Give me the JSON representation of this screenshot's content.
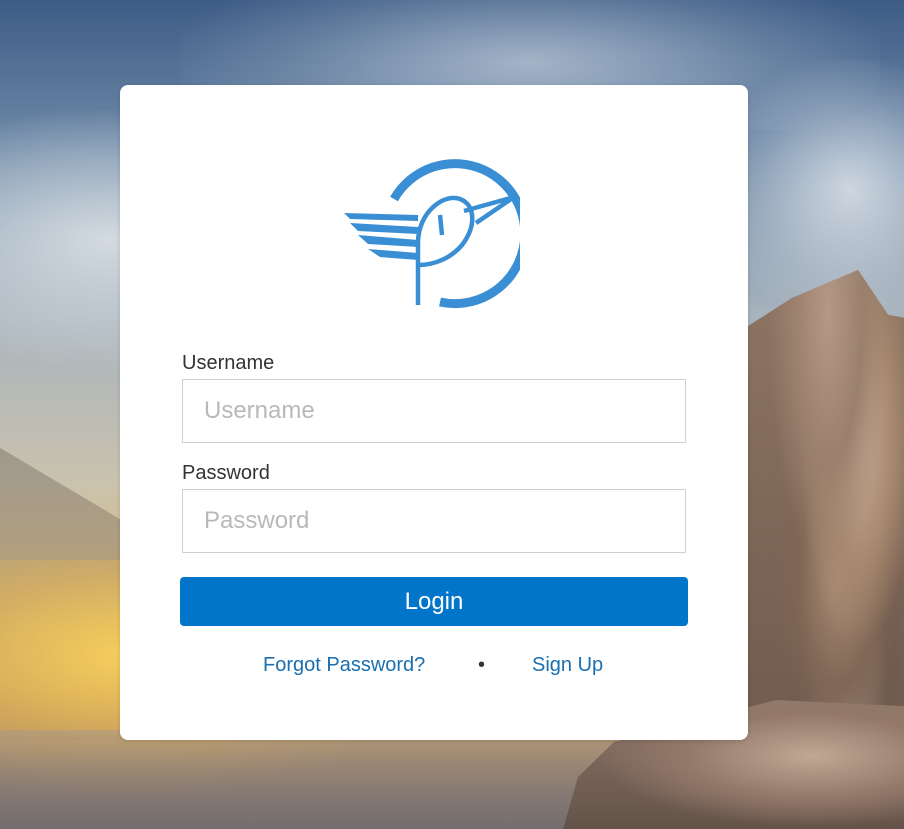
{
  "colors": {
    "accent": "#0075c9",
    "logo": "#3a8fd4",
    "link": "#1a6fb0",
    "card_background": "#ffffff"
  },
  "logo": {
    "icon": "bird-in-circle-logo"
  },
  "login_form": {
    "username": {
      "label": "Username",
      "value": "",
      "placeholder": "Username"
    },
    "password": {
      "label": "Password",
      "value": "",
      "placeholder": "Password"
    },
    "login_button_label": "Login",
    "forgot_password_label": "Forgot Password?",
    "separator": "•",
    "sign_up_label": "Sign Up"
  }
}
